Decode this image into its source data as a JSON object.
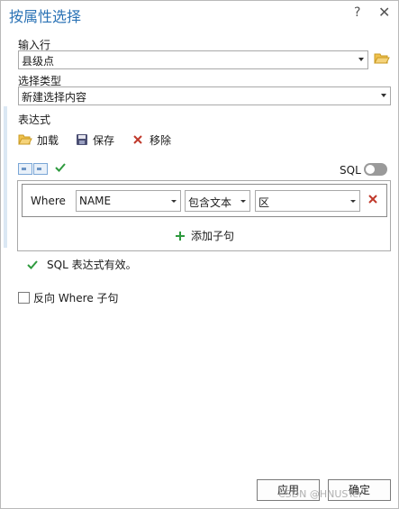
{
  "window": {
    "title": "按属性选择",
    "help": "?",
    "close": "✕"
  },
  "input_rows": {
    "label": "输入行",
    "value": "县级点"
  },
  "selection_type": {
    "label": "选择类型",
    "value": "新建选择内容"
  },
  "expression": {
    "label": "表达式",
    "toolbar": {
      "load": "加载",
      "save": "保存",
      "remove": "移除"
    },
    "sql_label": "SQL",
    "sql_toggle_on": false,
    "clause": {
      "where": "Where",
      "field": "NAME",
      "operator": "包含文本",
      "value": "区"
    },
    "add_clause": "添加子句",
    "status": "SQL 表达式有效。"
  },
  "invert": {
    "label": "反向 Where 子句",
    "checked": false
  },
  "buttons": {
    "apply": "应用",
    "ok": "确定"
  },
  "watermark": "CSDN @HNUSTer",
  "colors": {
    "title_blue": "#2a72b5",
    "check_green": "#2e9a3e",
    "remove_red": "#c0392b",
    "folder_yellow": "#e8b73a"
  }
}
